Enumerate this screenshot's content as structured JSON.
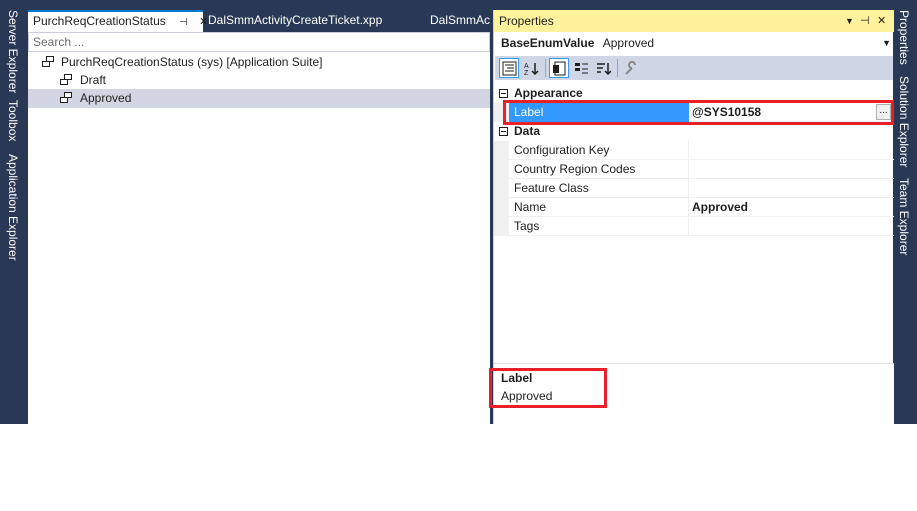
{
  "left_toolbars": [
    "Server Explorer",
    "Toolbox",
    "Application Explorer"
  ],
  "right_toolbars": [
    "Properties",
    "Solution Explorer",
    "Team Explorer"
  ],
  "document_tabs": [
    {
      "label": "PurchReqCreationStatus",
      "pin_icon": "pin-icon",
      "close_icon": "close-icon",
      "active": true
    },
    {
      "label": "DalSmmActivityCreateTicket.xpp",
      "active": false
    },
    {
      "label": "DalSmmActivityCreateTicket",
      "active": false
    }
  ],
  "search": {
    "placeholder": "Search ..."
  },
  "tree": [
    {
      "label": "PurchReqCreationStatus (sys) [Application Suite]",
      "icon": "enum-icon",
      "level": 0
    },
    {
      "label": "Draft",
      "icon": "enum-value-icon",
      "level": 1
    },
    {
      "label": "Approved",
      "icon": "enum-value-icon",
      "level": 1,
      "selected": true
    }
  ],
  "properties": {
    "title": "Properties",
    "title_buttons": [
      "dropdown-icon",
      "pin-icon",
      "close-icon"
    ],
    "object_type": "BaseEnumValue",
    "object_name": "Approved",
    "toolbar": [
      "categorized-icon",
      "alphabetical-icon",
      "properties-icon",
      "events-icon",
      "sort-icon",
      "property-pages-icon"
    ],
    "categories": [
      {
        "name": "Appearance",
        "rows": [
          {
            "name": "Label",
            "value": "@SYS10158",
            "selected": true,
            "has_ellipsis": true
          }
        ]
      },
      {
        "name": "Data",
        "rows": [
          {
            "name": "Configuration Key",
            "value": ""
          },
          {
            "name": "Country Region Codes",
            "value": ""
          },
          {
            "name": "Feature Class",
            "value": ""
          },
          {
            "name": "Name",
            "value": "Approved"
          },
          {
            "name": "Tags",
            "value": ""
          }
        ]
      }
    ],
    "ellipsis_label": "...",
    "description": {
      "title": "Label",
      "text": "Approved"
    }
  },
  "colors": {
    "frame": "#293955",
    "title_active": "#fff29d",
    "selection": "#3399ff",
    "highlight_box": "#e8202a"
  }
}
